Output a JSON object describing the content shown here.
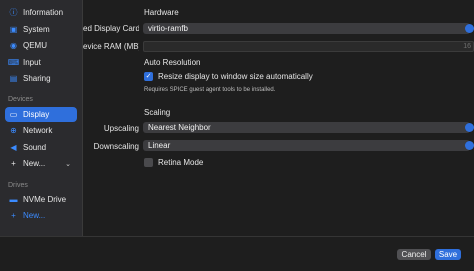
{
  "sidebar": {
    "items": [
      {
        "label": "Information",
        "icon": "info-circle-icon",
        "selected": false
      },
      {
        "label": "System",
        "icon": "cpu-icon",
        "selected": false
      },
      {
        "label": "QEMU",
        "icon": "qemu-icon",
        "selected": false
      },
      {
        "label": "Input",
        "icon": "keyboard-icon",
        "selected": false
      },
      {
        "label": "Sharing",
        "icon": "share-icon",
        "selected": false
      }
    ],
    "devices_label": "Devices",
    "devices": [
      {
        "label": "Display",
        "icon": "display-icon",
        "selected": true
      },
      {
        "label": "Network",
        "icon": "globe-icon",
        "selected": false
      },
      {
        "label": "Sound",
        "icon": "speaker-icon",
        "selected": false
      },
      {
        "label": "New...",
        "icon": "plus-icon",
        "selected": false
      }
    ],
    "drives_label": "Drives",
    "drives": [
      {
        "label": "NVMe Drive",
        "icon": "drive-icon"
      },
      {
        "label": "New...",
        "icon": "plus-icon"
      }
    ]
  },
  "hardware": {
    "header": "Hardware",
    "display_card_label": "ed Display Card",
    "display_card_value": "virtio-ramfb",
    "vram_label": "evice RAM (MB)",
    "vram_value": "16"
  },
  "auto_resolution": {
    "header": "Auto Resolution",
    "resize_label": "Resize display to window size automatically",
    "resize_checked": true,
    "note": "Requires SPICE guest agent tools to be installed."
  },
  "scaling": {
    "header": "Scaling",
    "upscaling_label": "Upscaling",
    "upscaling_value": "Nearest Neighbor",
    "downscaling_label": "Downscaling",
    "downscaling_value": "Linear",
    "retina_label": "Retina Mode",
    "retina_checked": false
  },
  "footer": {
    "cancel_label": "Cancel",
    "save_label": "Save"
  },
  "colors": {
    "accent": "#2f6fdc",
    "background": "#1e1e1e",
    "sidebar": "#2b2b2e"
  }
}
